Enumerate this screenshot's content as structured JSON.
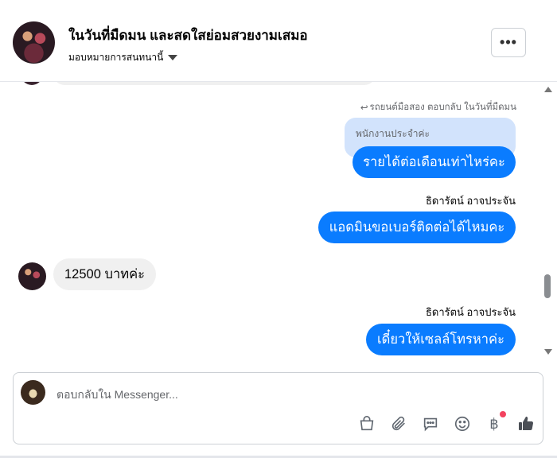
{
  "header": {
    "title": "ในวันที่มืดมน และสดใสย่อมสวยงามเสมอ",
    "assign_label": "มอบหมายการสนทนานี้",
    "more_label": "•••"
  },
  "thread": {
    "reply_note": "รถยนต์มือสอง ตอบกลับ ในวันที่มืดมน",
    "reply_icon": "↩",
    "quoted_text": "พนักงานประจำค่ะ",
    "messages": [
      {
        "direction": "out",
        "text": "รายได้ต่อเดือนเท่าไหร่คะ"
      },
      {
        "direction": "out",
        "sender": "ธิดารัตน์ อาจประจัน",
        "text": "แอดมินขอเบอร์ติดต่อได้ไหมคะ"
      },
      {
        "direction": "in",
        "text": "12500 บาทค่ะ"
      },
      {
        "direction": "out",
        "sender": "ธิดารัตน์ อาจประจัน",
        "text": "เดี๋ยวให้เซลล์โทรหาค่ะ"
      }
    ]
  },
  "composer": {
    "placeholder": "ตอบกลับใน Messenger...",
    "tools": [
      "shopping-bag-icon",
      "paperclip-icon",
      "chat-bubble-icon",
      "emoji-icon",
      "baht-icon",
      "thumbs-up-icon"
    ],
    "baht_symbol": "฿"
  },
  "colors": {
    "outgoing_bubble": "#0a7cff",
    "incoming_bubble": "#f0f0f0",
    "quote_bubble": "#d2e3fc",
    "notification_dot": "#f3425f"
  }
}
